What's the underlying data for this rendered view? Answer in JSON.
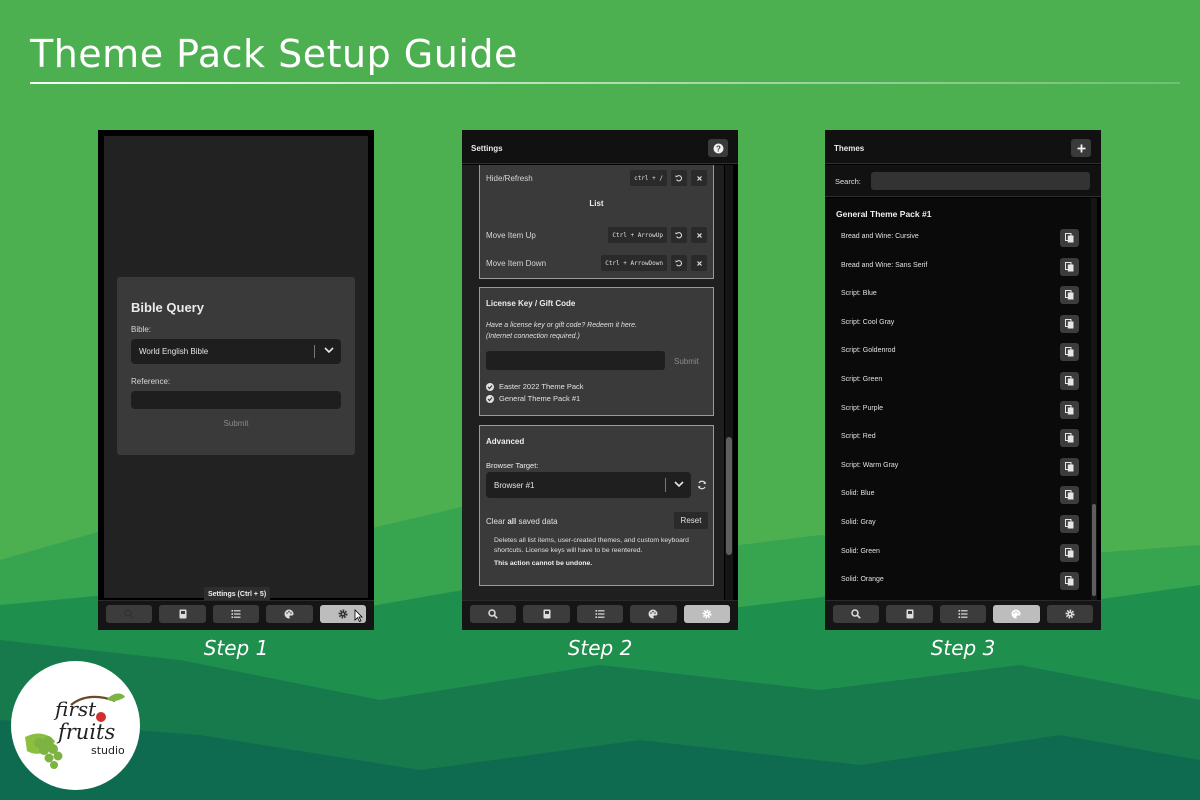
{
  "page": {
    "title": "Theme Pack Setup Guide"
  },
  "steps": [
    "Step 1",
    "Step 2",
    "Step 3"
  ],
  "step1": {
    "card_title": "Bible Query",
    "bible_label": "Bible:",
    "bible_value": "World English Bible",
    "reference_label": "Reference:",
    "reference_value": "",
    "submit_label": "Submit",
    "tooltip": "Settings (Ctrl + 5)",
    "active_tab": "settings"
  },
  "step2": {
    "header": "Settings",
    "shortcuts": {
      "hide_refresh": {
        "name": "Hide/Refresh",
        "key": "ctrl + /"
      },
      "list_heading": "List",
      "move_up": {
        "name": "Move Item Up",
        "key": "Ctrl + ArrowUp"
      },
      "move_down": {
        "name": "Move Item Down",
        "key": "Ctrl + ArrowDown"
      }
    },
    "license": {
      "title": "License Key / Gift Code",
      "line1": "Have a license key or gift code? Redeem it here.",
      "line2": "(Internet connection required.)",
      "input_value": "",
      "submit_label": "Submit",
      "items": [
        "Easter 2022 Theme Pack",
        "General Theme Pack #1"
      ]
    },
    "advanced": {
      "title": "Advanced",
      "browser_label": "Browser Target:",
      "browser_value": "Browser #1",
      "clear_pre": "Clear ",
      "clear_bold": "all",
      "clear_post": " saved data",
      "reset_label": "Reset",
      "note": "Deletes all list items, user-created themes, and custom keyboard shortcuts. License keys will have to be reentered.",
      "warning": "This action cannot be undone."
    },
    "active_tab": "settings"
  },
  "step3": {
    "header": "Themes",
    "search_label": "Search:",
    "search_value": "",
    "pack_title": "General Theme Pack #1",
    "themes": [
      "Bread and Wine: Cursive",
      "Bread and Wine: Sans Serif",
      "Script: Blue",
      "Script: Cool Gray",
      "Script: Goldenrod",
      "Script: Green",
      "Script: Purple",
      "Script: Red",
      "Script: Warm Gray",
      "Solid: Blue",
      "Solid: Gray",
      "Solid: Green",
      "Solid: Orange"
    ],
    "active_tab": "themes"
  },
  "nav_tabs": [
    {
      "id": "search",
      "icon": "search-icon"
    },
    {
      "id": "bible",
      "icon": "book-icon"
    },
    {
      "id": "list",
      "icon": "list-icon"
    },
    {
      "id": "themes",
      "icon": "palette-icon"
    },
    {
      "id": "settings",
      "icon": "gear-icon"
    }
  ],
  "logo": {
    "line1": "first",
    "line2": "fruits",
    "line3": "studio"
  },
  "colors": {
    "background_green": "#4caf50",
    "hill_dark": "#0f6b4f",
    "panel_dark": "#1f1f1f",
    "active_tab": "#bdbdbd"
  }
}
